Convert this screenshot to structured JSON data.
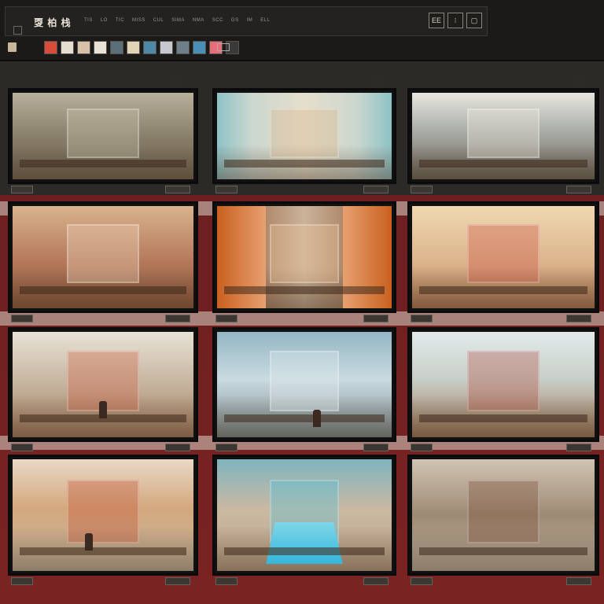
{
  "toolbar": {
    "logo_text": "㪅 柏 栈",
    "menu": [
      "TIS",
      "LO",
      "TIC",
      "MISS",
      "CUL",
      "SIMA",
      "NMA",
      "SCC",
      "GS",
      "IM",
      "ELL"
    ],
    "window_controls": [
      "EE",
      "⁝",
      "▢"
    ]
  },
  "thumbnails": [
    "#d84c3c",
    "#e6ded0",
    "#d9c0a8",
    "#e9e2d6",
    "#5a6f7a",
    "#e2d4b6",
    "#4f87a6",
    "#c6c9cf",
    "#6f7f8a",
    "#4a8fb5",
    "#e86d7a",
    "#3a3a3a"
  ],
  "screens": [
    {
      "name": "screen-1-courtyard",
      "bg": "linear-gradient(#b8b09c,#857b66 55%,#6f6653)",
      "accent": "#cfc5ae"
    },
    {
      "name": "screen-2-stair-hall",
      "bg": "linear-gradient(90deg,#8fc2c6 0%,#cbd7cf 20%,#e5dfcc 50%,#cbd7cf 80%,#8fc2c6 100%)",
      "accent": "#d7b087"
    },
    {
      "name": "screen-3-rotunda",
      "bg": "linear-gradient(#e7e6df,#a9aca6 45%,#6b655a)",
      "accent": "#efe9de"
    },
    {
      "name": "screen-4-red-hall",
      "bg": "linear-gradient(#d8b38e,#b4785a 55%,#8d5a3e)",
      "accent": "#f1d8bf"
    },
    {
      "name": "screen-5-orange-doors",
      "bg": "linear-gradient(90deg,#d06c2c 0%,#e6a06a 24%,#b18a6d 28%,#c9b39a 50%,#b18a6d 72%,#e6a06a 76%,#d06c2c 100%)",
      "accent": "#f0c69a"
    },
    {
      "name": "screen-6-gallery",
      "bg": "linear-gradient(#f0d8b2,#dcb48b 55%,#b27d58)",
      "accent": "#cd4c40"
    },
    {
      "name": "screen-7-temple-hall",
      "bg": "linear-gradient(#e8e2d6,#c5b39d 50%,#a77f61)",
      "accent": "#cf5a3c"
    },
    {
      "name": "screen-8-mist-hall",
      "bg": "linear-gradient(#94b6c4,#c9dae0 45%,#7f8e92)",
      "accent": "#e4eef0"
    },
    {
      "name": "screen-9-museum",
      "bg": "linear-gradient(#e2ebeb,#c8cec8 45%,#a27a5b)",
      "accent": "#b2483b"
    },
    {
      "name": "screen-10-palace-court",
      "bg": "linear-gradient(#e9d8c6,#d3a77c 45%,#c9bba6)",
      "accent": "#bf4b2e"
    },
    {
      "name": "screen-11-pool-court",
      "bg": "linear-gradient(#7fb4bf,#cab9a2 45%,#bfa58b)",
      "accent": "#4fc2de"
    },
    {
      "name": "screen-12-arcade-street",
      "bg": "linear-gradient(#cfc4b2,#9e8a74 50%,#c5b8a6)",
      "accent": "#7c4b35"
    }
  ]
}
